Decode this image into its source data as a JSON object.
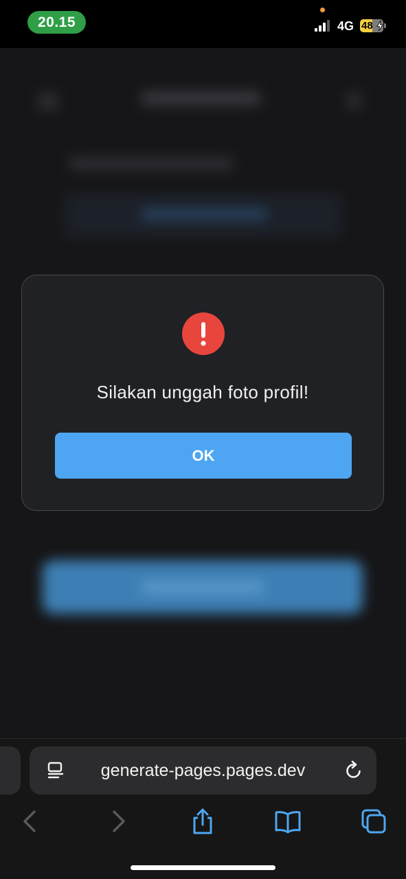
{
  "status_bar": {
    "time": "20.15",
    "network": "4G",
    "battery": "48"
  },
  "dialog": {
    "message": "Silakan unggah foto profil!",
    "ok_label": "OK",
    "icon": "exclamation-circle-icon"
  },
  "browser": {
    "url": "generate-pages.pages.dev",
    "icons": [
      "page-menu-icon",
      "reload-icon",
      "back-icon",
      "forward-icon",
      "share-icon",
      "bookmarks-icon",
      "tabs-icon"
    ]
  },
  "colors": {
    "status_time_bg": "#2f9e47",
    "alert_icon": "#e8453c",
    "ok_button": "#4ea6f2",
    "dialog_bg": "#202124",
    "toolbar_icon": "#4ea6f2",
    "battery": "#f5cf3f"
  }
}
